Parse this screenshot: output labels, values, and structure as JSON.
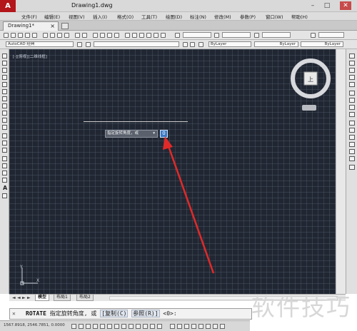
{
  "app": {
    "title": "Drawing1.dwg",
    "window_controls": [
      "–",
      "□",
      "✕"
    ]
  },
  "menu": {
    "items": [
      "文件(F)",
      "编辑(E)",
      "视图(V)",
      "插入(I)",
      "格式(O)",
      "工具(T)",
      "绘图(D)",
      "标注(N)",
      "修改(M)",
      "参数(P)",
      "窗口(W)",
      "帮助(H)"
    ]
  },
  "tabs": {
    "document": "Drawing1*",
    "close_glyph": "×"
  },
  "toolbar": {
    "workspace": "AutoCAD 经典",
    "layer_color": "ByLayer",
    "linetype": "ByLayer",
    "lineweight": "ByLayer"
  },
  "viewport": {
    "label": "[-][俯视][二维线框]",
    "viewcube_face": "上"
  },
  "dynamic_input": {
    "prompt": "指定旋转角度，或",
    "value": "0",
    "dropdown_glyph": "▾"
  },
  "ucs": {
    "x": "X",
    "y": "Y"
  },
  "layout_tabs": {
    "items": [
      "模型",
      "布局1",
      "布局2"
    ],
    "active": "模型",
    "nav": [
      "◄",
      "◄",
      "►",
      "►"
    ]
  },
  "command_line": {
    "close_glyph": "✕",
    "command": "ROTATE",
    "text": "指定旋转角度, 或",
    "options": [
      "[复制(C)",
      "参照(R)]"
    ],
    "default": "<0>:"
  },
  "statusbar": {
    "coordinates": "1567.8918, 2546.7851, 0.0000"
  },
  "watermark": "软件技巧",
  "colors": {
    "canvas": "#212732",
    "accent": "#3a79c5",
    "arrow": "#e02a2a",
    "logo": "#b3161b"
  },
  "icons": [
    "app-logo-icon",
    "viewcube-icon",
    "ucs-icon",
    "red-pointer-arrow"
  ]
}
